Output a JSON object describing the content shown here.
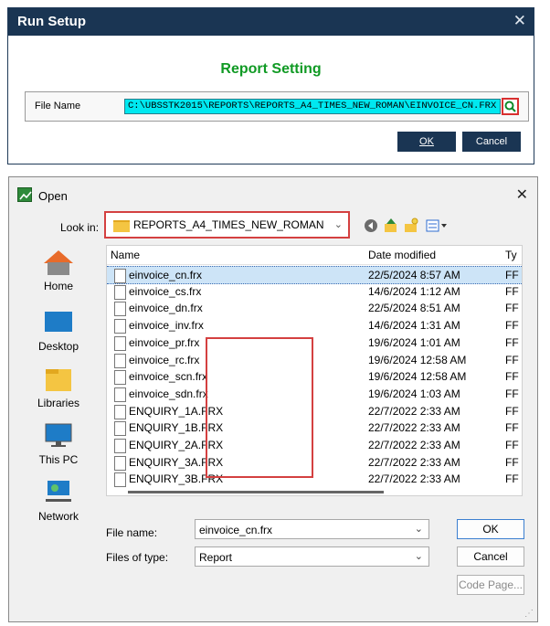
{
  "run_setup": {
    "title": "Run Setup",
    "close_glyph": "✕",
    "heading": "Report Setting",
    "file_name_label": "File Name",
    "file_name_value": "C:\\UBSSTK2015\\REPORTS\\REPORTS_A4_TIMES_NEW_ROMAN\\EINVOICE_CN.FRX",
    "ok_label": "OK",
    "cancel_label": "Cancel",
    "browse_icon": "search-icon",
    "colors": {
      "titlebar": "#1a3553",
      "heading": "#109a24",
      "field": "#00e8f0"
    }
  },
  "open_dialog": {
    "title": "Open",
    "close_glyph": "✕",
    "look_in_label": "Look in:",
    "look_in_value": "REPORTS_A4_TIMES_NEW_ROMAN",
    "toolbar_icons": [
      "back-icon",
      "up-folder-icon",
      "new-folder-icon",
      "view-menu-icon"
    ],
    "places": [
      {
        "label": "Home",
        "icon": "home-icon"
      },
      {
        "label": "Desktop",
        "icon": "desktop-icon"
      },
      {
        "label": "Libraries",
        "icon": "libraries-icon"
      },
      {
        "label": "This PC",
        "icon": "this-pc-icon"
      },
      {
        "label": "Network",
        "icon": "network-icon"
      }
    ],
    "columns": [
      "Name",
      "Date modified",
      "Ty"
    ],
    "files": [
      {
        "name": "einvoice_cn.frx",
        "date": "22/5/2024 8:57 AM",
        "type": "FF",
        "selected": true
      },
      {
        "name": "einvoice_cs.frx",
        "date": "14/6/2024 1:12 AM",
        "type": "FF"
      },
      {
        "name": "einvoice_dn.frx",
        "date": "22/5/2024 8:51 AM",
        "type": "FF"
      },
      {
        "name": "einvoice_inv.frx",
        "date": "14/6/2024 1:31 AM",
        "type": "FF"
      },
      {
        "name": "einvoice_pr.frx",
        "date": "19/6/2024 1:01 AM",
        "type": "FF"
      },
      {
        "name": "einvoice_rc.frx",
        "date": "19/6/2024 12:58 AM",
        "type": "FF"
      },
      {
        "name": "einvoice_scn.frx",
        "date": "19/6/2024 12:58 AM",
        "type": "FF"
      },
      {
        "name": "einvoice_sdn.frx",
        "date": "19/6/2024 1:03 AM",
        "type": "FF"
      },
      {
        "name": "ENQUIRY_1A.FRX",
        "date": "22/7/2022 2:33 AM",
        "type": "FF"
      },
      {
        "name": "ENQUIRY_1B.FRX",
        "date": "22/7/2022 2:33 AM",
        "type": "FF"
      },
      {
        "name": "ENQUIRY_2A.FRX",
        "date": "22/7/2022 2:33 AM",
        "type": "FF"
      },
      {
        "name": "ENQUIRY_3A.FRX",
        "date": "22/7/2022 2:33 AM",
        "type": "FF"
      },
      {
        "name": "ENQUIRY_3B.FRX",
        "date": "22/7/2022 2:33 AM",
        "type": "FF"
      }
    ],
    "file_name_label": "File name:",
    "file_name_value": "einvoice_cn.frx",
    "files_of_type_label": "Files of type:",
    "files_of_type_value": "Report",
    "ok_label": "OK",
    "cancel_label": "Cancel",
    "code_page_label": "Code Page...",
    "highlight_color": "#d44040"
  }
}
